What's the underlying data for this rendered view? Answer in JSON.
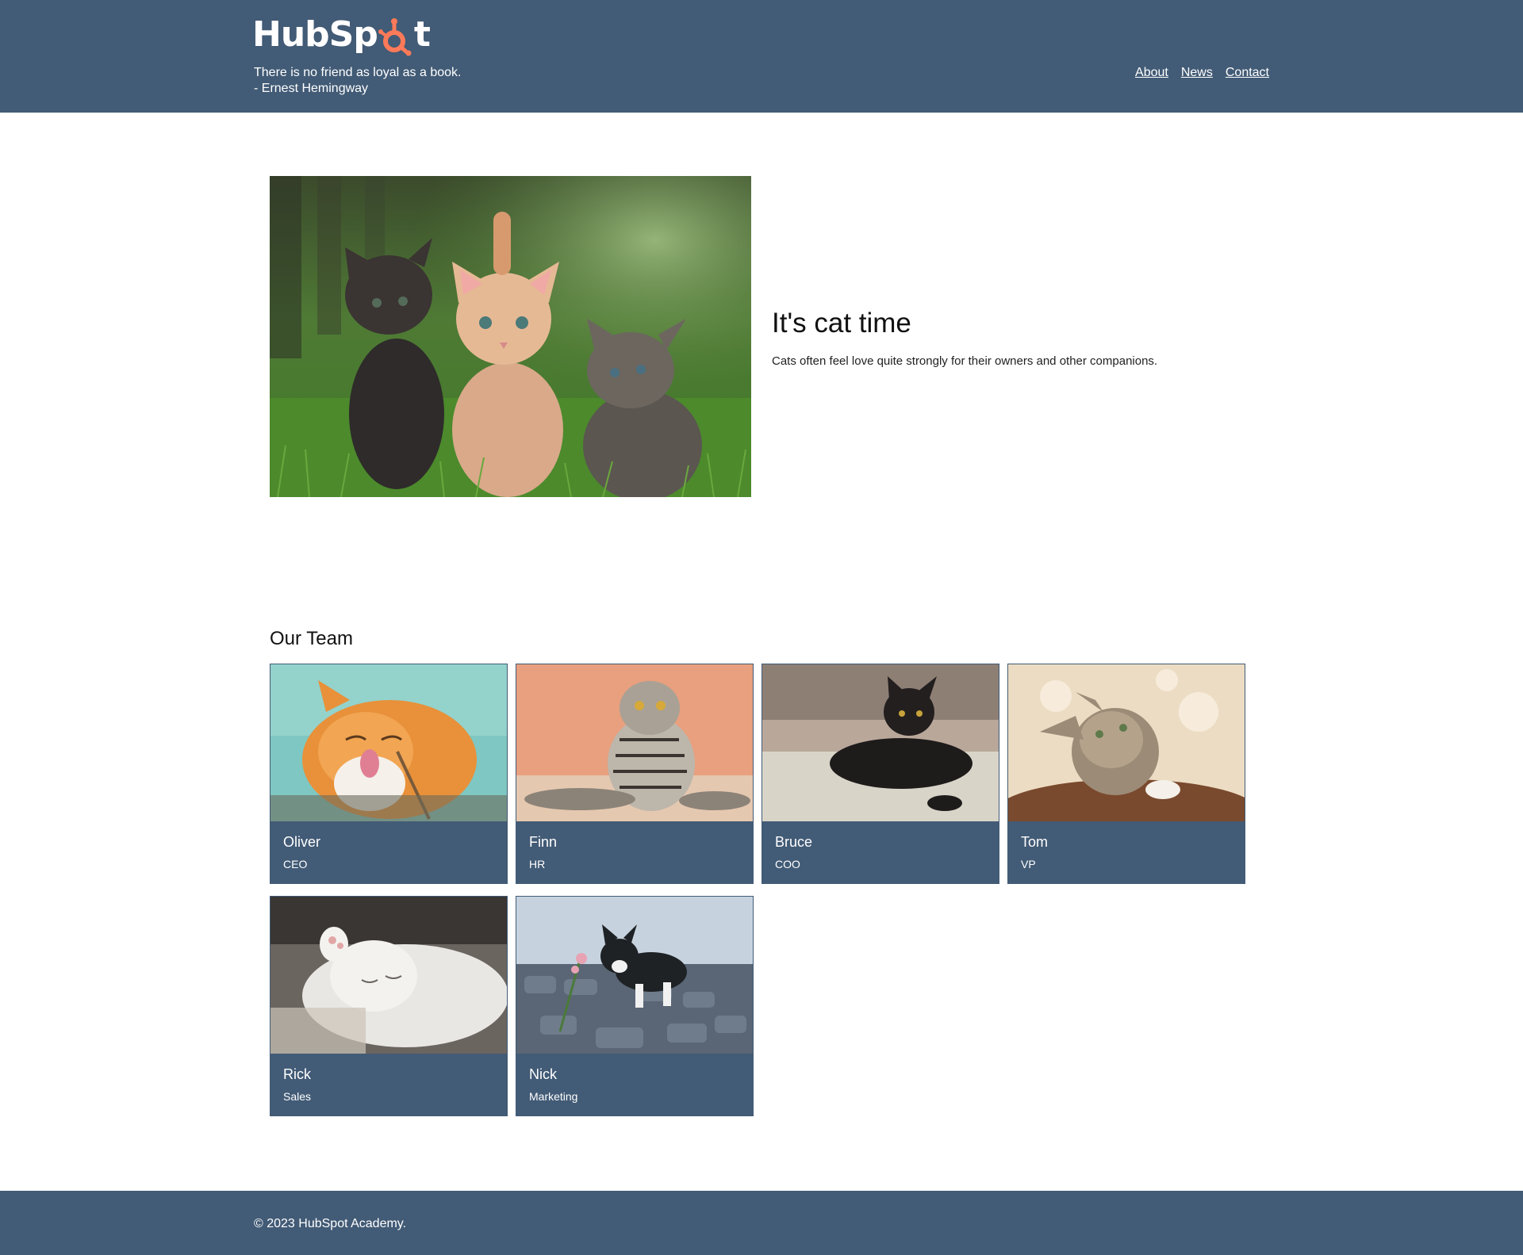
{
  "header": {
    "logo_text_left": "HubSp",
    "logo_text_right": "t",
    "quote": "There is no friend as loyal as a book.",
    "quote_author": "- Ernest Hemingway",
    "nav": [
      {
        "label": "About"
      },
      {
        "label": "News"
      },
      {
        "label": "Contact"
      }
    ]
  },
  "hero": {
    "title": "It's cat time",
    "description": "Cats often feel love quite strongly for their owners and other companions."
  },
  "team": {
    "heading": "Our Team",
    "members": [
      {
        "name": "Oliver",
        "role": "CEO"
      },
      {
        "name": "Finn",
        "role": "HR"
      },
      {
        "name": "Bruce",
        "role": "COO"
      },
      {
        "name": "Tom",
        "role": "VP"
      },
      {
        "name": "Rick",
        "role": "Sales"
      },
      {
        "name": "Nick",
        "role": "Marketing"
      }
    ]
  },
  "footer": {
    "copyright": "© 2023 HubSpot Academy."
  },
  "colors": {
    "brand_navy": "#425b76",
    "brand_orange": "#ff7a59"
  }
}
